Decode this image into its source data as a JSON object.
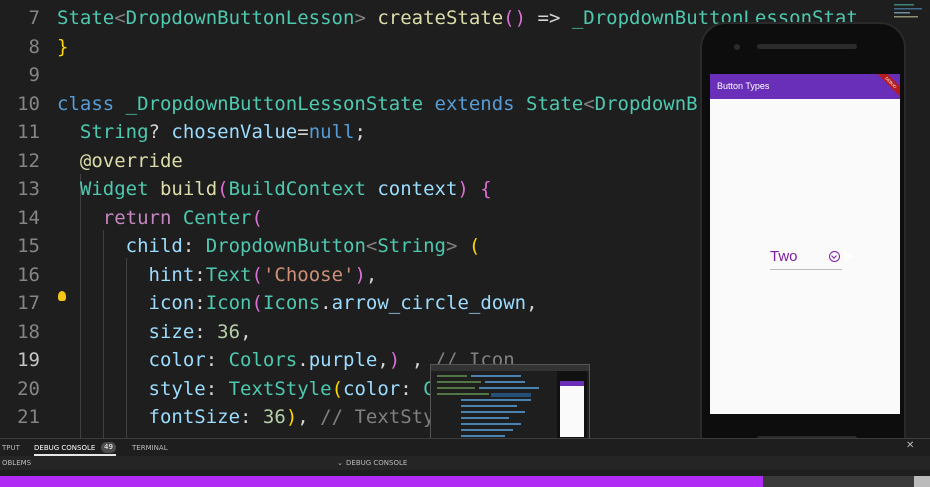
{
  "editor": {
    "lines": [
      {
        "num": "7",
        "parts": [
          [
            "State",
            "k-type"
          ],
          [
            "<",
            "k-dim"
          ],
          [
            "DropdownButtonLesson",
            "k-type"
          ],
          [
            "> ",
            "k-dim"
          ],
          [
            "createState",
            "k-fn"
          ],
          [
            "() ",
            "k-par2"
          ],
          [
            "=> ",
            ""
          ],
          [
            "_DropdownButtonLessonStat",
            "k-type"
          ]
        ]
      },
      {
        "num": "8",
        "parts": [
          [
            "}",
            "k-par"
          ]
        ]
      },
      {
        "num": "9",
        "parts": []
      },
      {
        "num": "10",
        "parts": [
          [
            "class ",
            "k-blue"
          ],
          [
            "_DropdownButtonLessonState ",
            "k-type"
          ],
          [
            "extends ",
            "k-blue"
          ],
          [
            "State",
            "k-type"
          ],
          [
            "<",
            "k-dim"
          ],
          [
            "DropdownB",
            "k-type"
          ]
        ]
      },
      {
        "num": "11",
        "parts": [
          [
            "  String",
            "k-type"
          ],
          [
            "? ",
            ""
          ],
          [
            "chosenValue",
            "k-var"
          ],
          [
            "=",
            ""
          ],
          [
            "null",
            "k-blue"
          ],
          [
            ";",
            ""
          ]
        ]
      },
      {
        "num": "12",
        "parts": [
          [
            "  @override",
            "k-fn"
          ]
        ]
      },
      {
        "num": "13",
        "parts": [
          [
            "  Widget ",
            "k-type"
          ],
          [
            "build",
            "k-fn"
          ],
          [
            "(",
            "k-par2"
          ],
          [
            "BuildContext ",
            "k-type"
          ],
          [
            "context",
            "k-var"
          ],
          [
            ") ",
            "k-par2"
          ],
          [
            "{",
            "k-par2"
          ]
        ]
      },
      {
        "num": "14",
        "parts": [
          [
            "    return ",
            "k-purple"
          ],
          [
            "Center",
            "k-type"
          ],
          [
            "(",
            "k-par2"
          ]
        ]
      },
      {
        "num": "15",
        "parts": [
          [
            "      child",
            "k-var"
          ],
          [
            ": ",
            ""
          ],
          [
            "DropdownButton",
            "k-type"
          ],
          [
            "<",
            "k-dim"
          ],
          [
            "String",
            "k-type"
          ],
          [
            "> ",
            "k-dim"
          ],
          [
            "(",
            "k-par"
          ]
        ]
      },
      {
        "num": "16",
        "parts": [
          [
            "        hint",
            "k-var"
          ],
          [
            ":",
            ""
          ],
          [
            "Text",
            "k-type"
          ],
          [
            "(",
            "k-par2"
          ],
          [
            "'Choose'",
            "k-str"
          ],
          [
            ")",
            "k-par2"
          ],
          [
            ",",
            ""
          ]
        ]
      },
      {
        "num": "17",
        "parts": [
          [
            "        icon",
            "k-var"
          ],
          [
            ":",
            ""
          ],
          [
            "Icon",
            "k-type"
          ],
          [
            "(",
            "k-par2"
          ],
          [
            "Icons",
            "k-type"
          ],
          [
            ".",
            ""
          ],
          [
            "arrow_circle_down",
            "k-var"
          ],
          [
            ",",
            ""
          ]
        ]
      },
      {
        "num": "18",
        "parts": [
          [
            "        size",
            "k-var"
          ],
          [
            ": ",
            ""
          ],
          [
            "36",
            "k-num"
          ],
          [
            ",",
            ""
          ]
        ]
      },
      {
        "num": "19",
        "parts": [
          [
            "        color",
            "k-var"
          ],
          [
            ": ",
            ""
          ],
          [
            "Colors",
            "k-type"
          ],
          [
            ".",
            ""
          ],
          [
            "purple",
            "k-var"
          ],
          [
            ",",
            ""
          ],
          [
            ") ",
            "k-par2"
          ],
          [
            ", ",
            ""
          ],
          [
            "// Icon",
            "k-dim"
          ]
        ]
      },
      {
        "num": "20",
        "parts": [
          [
            "        style",
            "k-var"
          ],
          [
            ": ",
            ""
          ],
          [
            "TextStyle",
            "k-type"
          ],
          [
            "(",
            "k-par"
          ],
          [
            "color",
            "k-var"
          ],
          [
            ": ",
            ""
          ],
          [
            "C",
            "k-type"
          ]
        ]
      },
      {
        "num": "21",
        "parts": [
          [
            "        fontSize",
            "k-var"
          ],
          [
            ": ",
            ""
          ],
          [
            "36",
            "k-num"
          ],
          [
            ")",
            "k-par"
          ],
          [
            ", ",
            ""
          ],
          [
            "// TextSty",
            "k-dim"
          ]
        ]
      }
    ]
  },
  "panel": {
    "tab_output": "TPUT",
    "tab_debug_console": "DEBUG CONSOLE",
    "debug_badge": "49",
    "tab_terminal": "TERMINAL",
    "problems_label": "OBLEMS",
    "debug_console_header": "DEBUG CONSOLE"
  },
  "phone": {
    "appbar_title": "Button Types",
    "debug_banner": "DEBUG",
    "dropdown_value": "Two"
  },
  "progress": {
    "fraction": 0.82,
    "fill_color": "#b02cf5"
  },
  "icons": [
    "lightbulb-icon",
    "arrow-circle-down-icon",
    "close-icon",
    "chevron-down-icon"
  ]
}
